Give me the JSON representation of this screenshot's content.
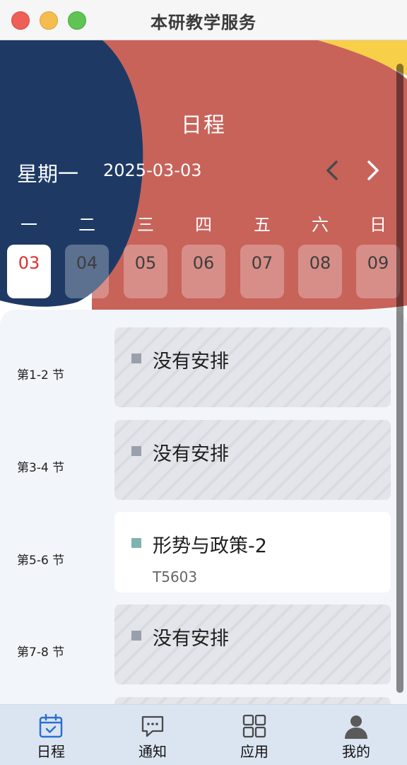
{
  "window": {
    "title": "本研教学服务"
  },
  "header": {
    "page_title": "日程",
    "weekday": "星期一",
    "date": "2025-03-03",
    "weekdays": [
      "一",
      "二",
      "三",
      "四",
      "五",
      "六",
      "日"
    ],
    "dates": [
      "03",
      "04",
      "05",
      "06",
      "07",
      "08",
      "09"
    ],
    "selected_index": 0,
    "colors": {
      "red": "#c8635a",
      "navy": "#1e3a64",
      "yellow": "#f7cf48"
    }
  },
  "schedule": {
    "slots": [
      {
        "label": "第1-2 节",
        "title": "没有安排",
        "room": "",
        "empty": true
      },
      {
        "label": "第3-4 节",
        "title": "没有安排",
        "room": "",
        "empty": true
      },
      {
        "label": "第5-6 节",
        "title": "形势与政策-2",
        "room": "T5603",
        "empty": false
      },
      {
        "label": "第7-8 节",
        "title": "没有安排",
        "room": "",
        "empty": true
      }
    ],
    "empty_dot_color": "#9aa0ab",
    "course_dot_color": "#7fb3ad"
  },
  "tabbar": {
    "items": [
      {
        "label": "日程",
        "icon": "calendar-icon"
      },
      {
        "label": "通知",
        "icon": "message-icon"
      },
      {
        "label": "应用",
        "icon": "apps-grid-icon"
      },
      {
        "label": "我的",
        "icon": "person-icon"
      }
    ],
    "active_color": "#2d6fd2"
  }
}
